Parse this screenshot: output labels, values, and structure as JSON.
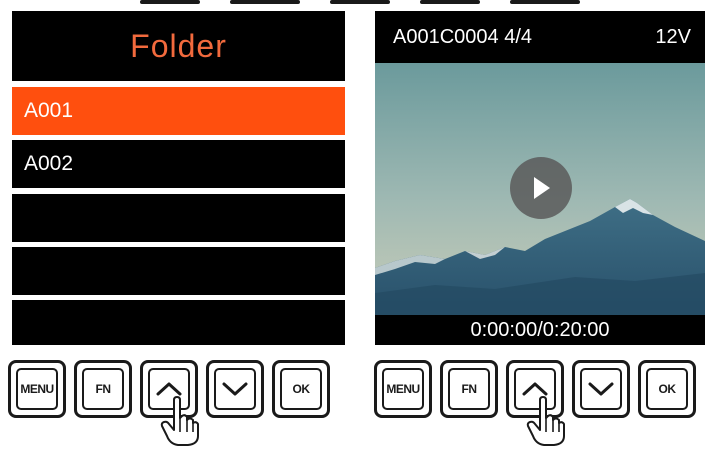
{
  "folder_screen": {
    "title": "Folder",
    "items": [
      {
        "label": "A001",
        "selected": true
      },
      {
        "label": "A002",
        "selected": false
      },
      {
        "label": "",
        "selected": false
      },
      {
        "label": "",
        "selected": false
      },
      {
        "label": ""
      }
    ],
    "title_color": "#f26a3d",
    "highlight_color": "#ff4f0e"
  },
  "player_screen": {
    "clip_info": "A001C0004 4/4",
    "voltage": "12V",
    "timecode": "0:00:00/0:20:00",
    "play_icon": "play-icon"
  },
  "left_buttons": {
    "menu_label": "MENU",
    "fn_label": "FN",
    "up_icon": "chevron-up-icon",
    "down_icon": "chevron-down-icon",
    "ok_label": "OK"
  },
  "right_buttons": {
    "menu_label": "MENU",
    "fn_label": "FN",
    "up_icon": "chevron-up-icon",
    "down_icon": "chevron-down-icon",
    "ok_label": "OK"
  }
}
